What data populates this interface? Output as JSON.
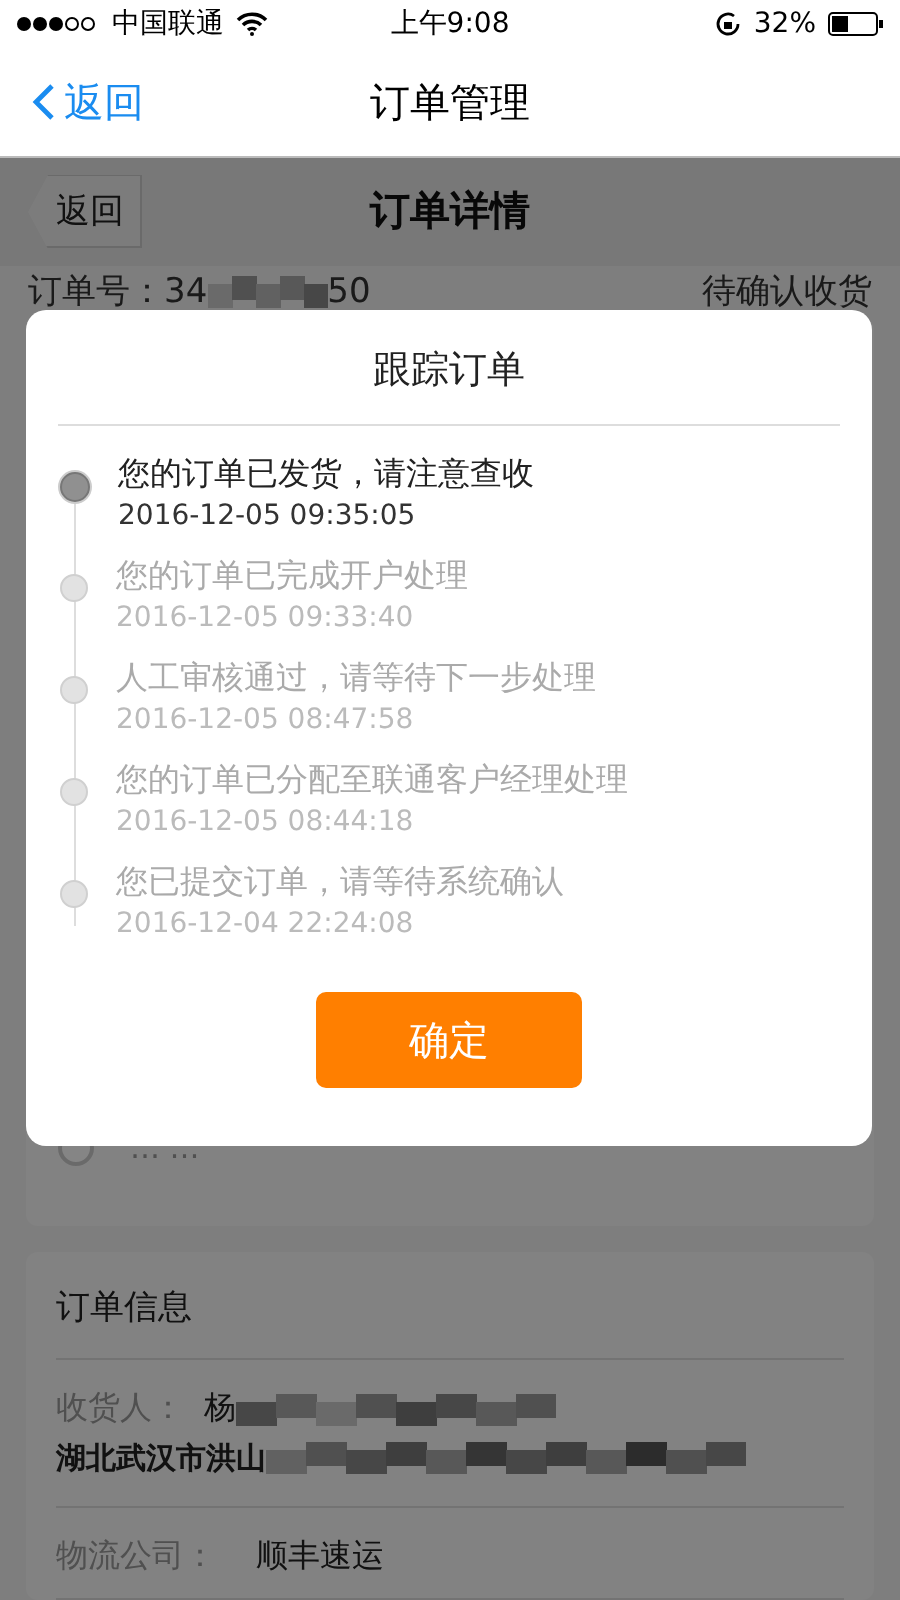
{
  "status_bar": {
    "carrier": "中国联通",
    "time": "上午9:08",
    "battery": "32%"
  },
  "nav_bar": {
    "back": "返回",
    "title": "订单管理"
  },
  "page": {
    "back": "返回",
    "title": "订单详情",
    "order_label": "订单号：",
    "order_start": "34",
    "order_end": "50",
    "order_status": "待确认收货",
    "more": "… …",
    "info_card": {
      "title": "订单信息",
      "receiver_label": "收货人：",
      "receiver_name": "杨",
      "address": "湖北武汉市洪山",
      "carrier_label": "物流公司：",
      "carrier": "顺丰速运"
    }
  },
  "dialog": {
    "title": "跟踪订单",
    "button": "确定",
    "events": [
      {
        "text": "您的订单已发货，请注意查收",
        "time": "2016-12-05 09:35:05",
        "current": true
      },
      {
        "text": "您的订单已完成开户处理",
        "time": "2016-12-05 09:33:40",
        "current": false
      },
      {
        "text": "人工审核通过，请等待下一步处理",
        "time": "2016-12-05 08:47:58",
        "current": false
      },
      {
        "text": "您的订单已分配至联通客户经理处理",
        "time": "2016-12-05 08:44:18",
        "current": false
      },
      {
        "text": "您已提交订单，请等待系统确认",
        "time": "2016-12-04 22:24:08",
        "current": false
      }
    ]
  }
}
